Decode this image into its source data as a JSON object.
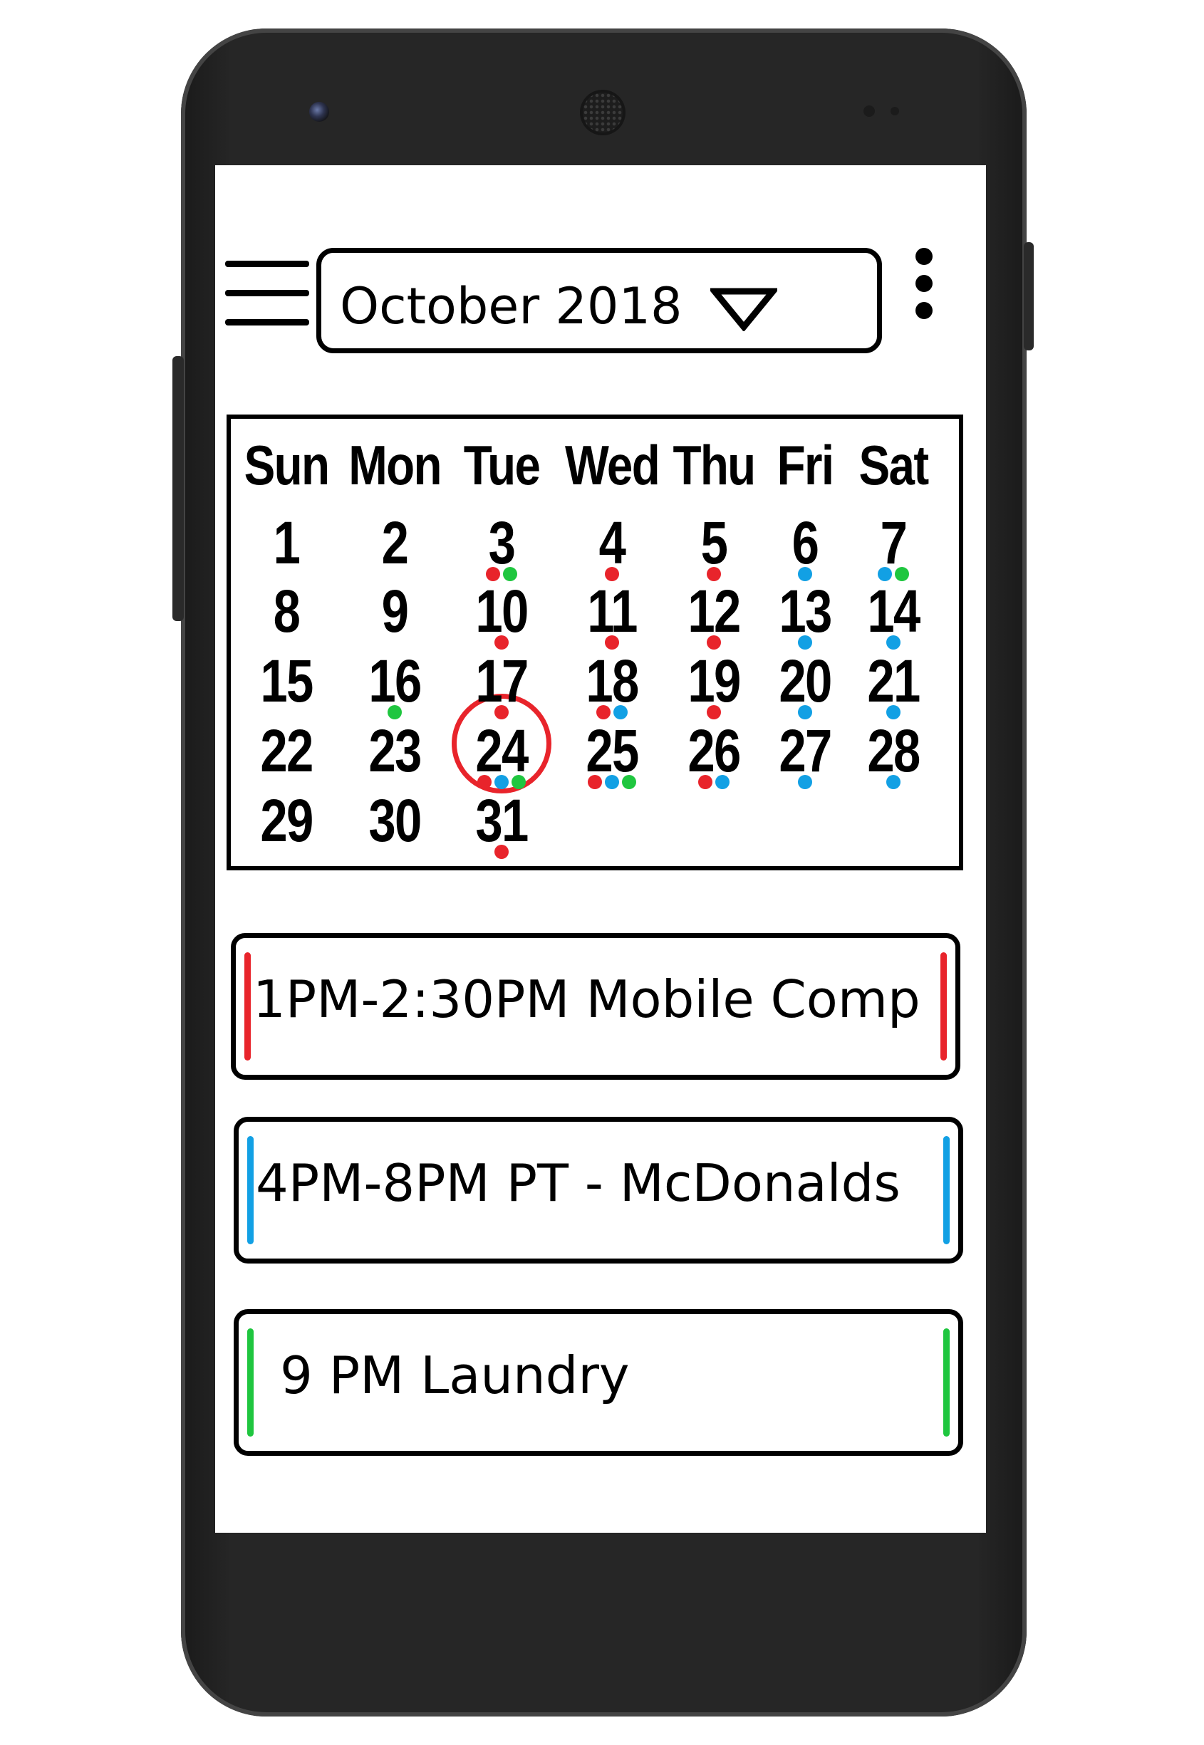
{
  "header": {
    "month_label": "October 2018",
    "menu_icon": "hamburger-menu-icon",
    "dropdown_icon": "triangle-down-icon",
    "more_icon": "more-vertical-icon"
  },
  "calendar": {
    "weekdays": [
      "Sun",
      "Mon",
      "Tue",
      "Wed",
      "Thu",
      "Fri",
      "Sat"
    ],
    "days": [
      "1",
      "2",
      "3",
      "4",
      "5",
      "6",
      "7",
      "8",
      "9",
      "10",
      "11",
      "12",
      "13",
      "14",
      "15",
      "16",
      "17",
      "18",
      "19",
      "20",
      "21",
      "22",
      "23",
      "24",
      "25",
      "26",
      "27",
      "28",
      "29",
      "30",
      "31"
    ],
    "today": "24",
    "event_markers": {
      "3": [
        "red",
        "green"
      ],
      "4": [
        "red"
      ],
      "5": [
        "red"
      ],
      "6": [
        "blue"
      ],
      "7": [
        "blue",
        "green"
      ],
      "10": [
        "red"
      ],
      "11": [
        "red"
      ],
      "12": [
        "red"
      ],
      "13": [
        "blue"
      ],
      "14": [
        "blue"
      ],
      "16": [
        "green"
      ],
      "17": [
        "red"
      ],
      "18": [
        "red",
        "blue"
      ],
      "19": [
        "red"
      ],
      "20": [
        "blue"
      ],
      "21": [
        "blue"
      ],
      "24": [
        "red",
        "blue",
        "green"
      ],
      "25": [
        "red",
        "blue",
        "green"
      ],
      "26": [
        "red",
        "blue"
      ],
      "27": [
        "blue"
      ],
      "28": [
        "blue"
      ],
      "31": [
        "red"
      ]
    }
  },
  "colors": {
    "red": "#e8242b",
    "blue": "#12a0e4",
    "green": "#1fc63f"
  },
  "events": [
    {
      "text": "1PM-2:30PM Mobile Comp",
      "color": "red"
    },
    {
      "text": "4PM-8PM PT - McDonalds",
      "color": "blue"
    },
    {
      "text": "9 PM Laundry",
      "color": "green"
    }
  ]
}
